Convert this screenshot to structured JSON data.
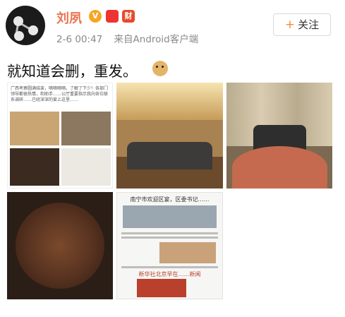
{
  "user": {
    "name": "刘夙",
    "badge_vip": "V",
    "badge_red": "",
    "badge_fin": "财"
  },
  "meta": {
    "time": "2-6 00:47",
    "source": "来自Android客户端"
  },
  "follow": {
    "plus": "+",
    "label": "关注"
  },
  "post": {
    "text": "就知道会删，重发。"
  },
  "images": {
    "img1_caption": "广西考察圆满结束，嘀嘀嘀嘀。了解了下少！各部门领导都很热情，和助手……公厅重要指示我向各位联系调研……已经深深的爱上这里……",
    "img5_headline": "南宁市欢迎区宴，区委书记……",
    "img5_subheadline": "新华社北京早在……新闻"
  },
  "colors": {
    "name": "#eb7350",
    "accent": "#f48a3a"
  }
}
